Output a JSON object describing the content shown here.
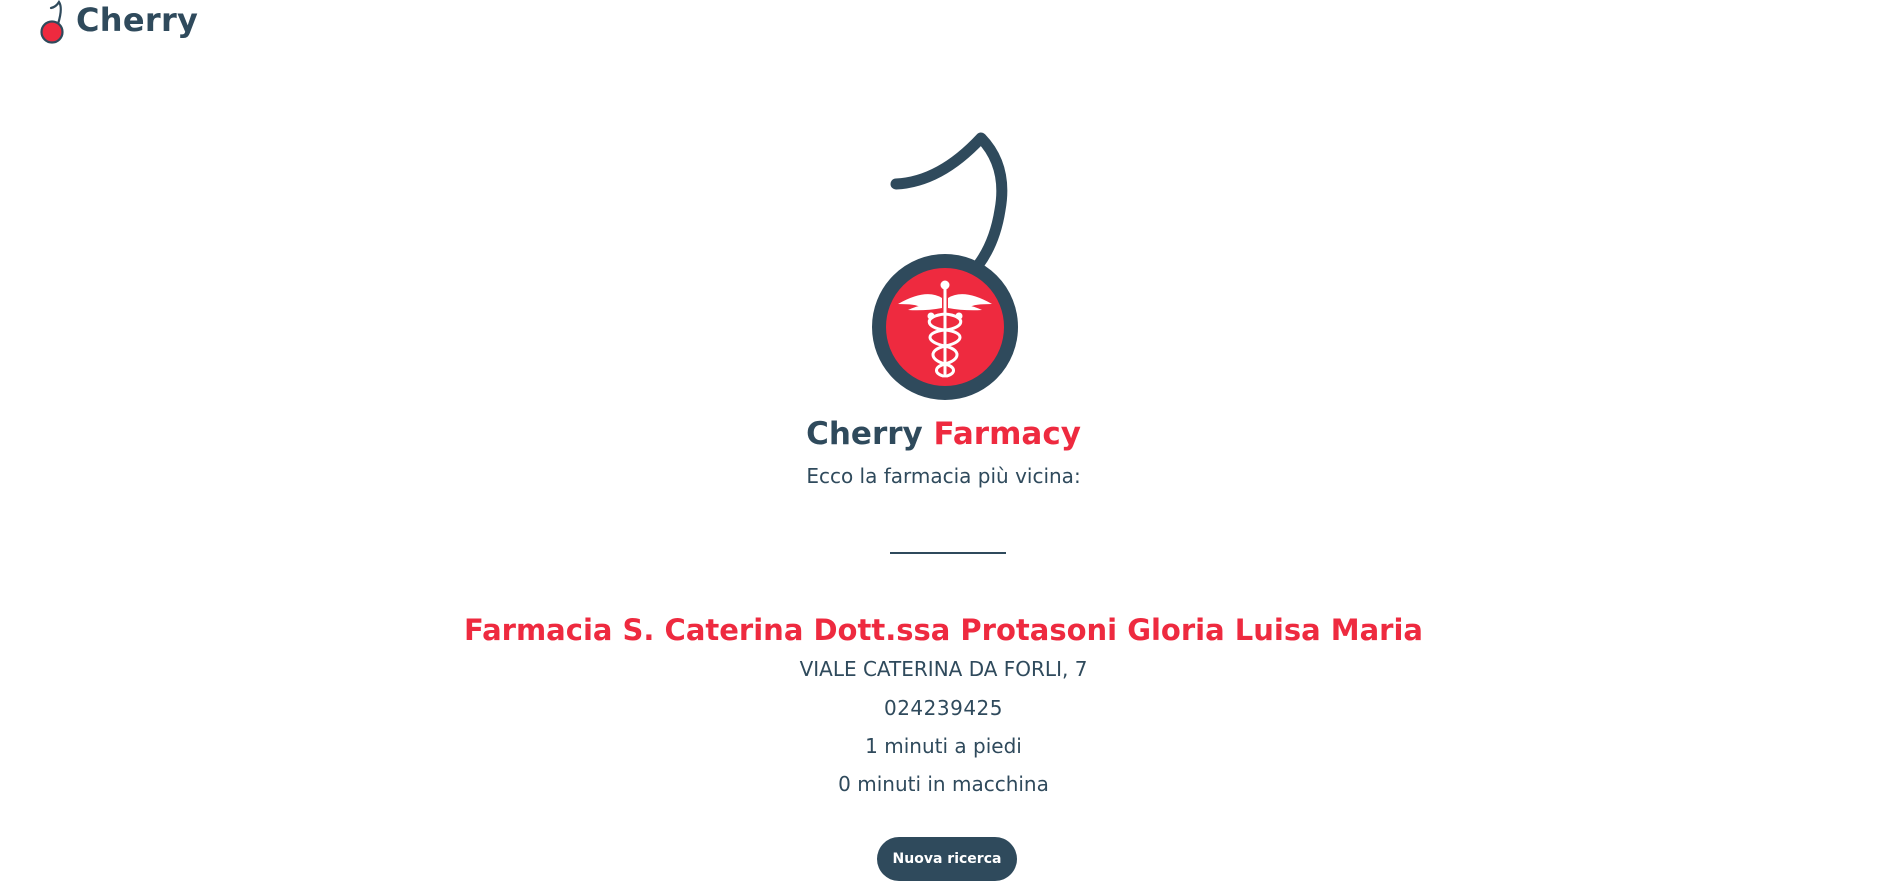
{
  "header": {
    "brand": "Cherry",
    "logo_icon": "cherry-logo-icon"
  },
  "hero": {
    "icon": "cherry-caduceus-icon",
    "title_part1": "Cherry",
    "title_part2": "Farmacy",
    "subtitle": "Ecco la farmacia più vicina:"
  },
  "result": {
    "name": "Farmacia S. Caterina Dott.ssa Protasoni Gloria Luisa Maria",
    "address": "VIALE CATERINA DA FORLI, 7",
    "phone": "024239425",
    "walk_time": "1 minuti a piedi",
    "car_time": "0 minuti in macchina"
  },
  "actions": {
    "new_search_label": "Nuova ricerca"
  },
  "colors": {
    "primary": "#2f4a5c",
    "accent": "#ee2a3f",
    "background": "#ffffff"
  }
}
